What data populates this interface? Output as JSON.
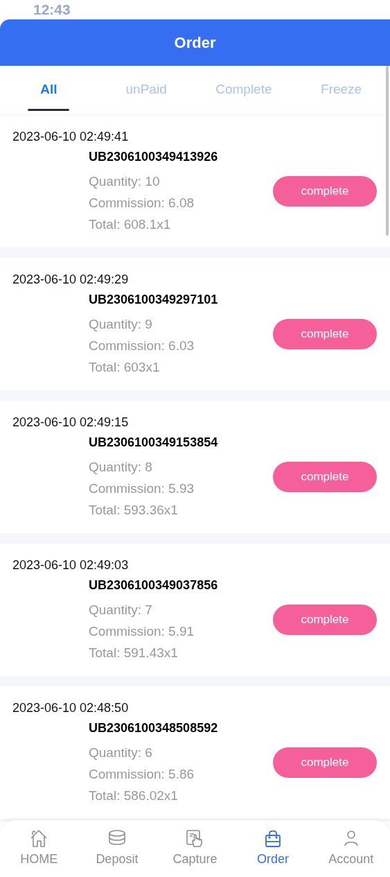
{
  "status_bar": {
    "time": "12:43"
  },
  "header": {
    "title": "Order"
  },
  "tabs": [
    {
      "label": "All",
      "selected": true
    },
    {
      "label": "unPaid",
      "selected": false
    },
    {
      "label": "Complete",
      "selected": false
    },
    {
      "label": "Freeze",
      "selected": false
    }
  ],
  "orders": [
    {
      "time": "2023-06-10 02:49:41",
      "order_no": "UB2306100349413926",
      "quantity": "Quantity: 10",
      "commission": "Commission: 6.08",
      "total": "Total: 608.1x1",
      "action": "complete"
    },
    {
      "time": "2023-06-10 02:49:29",
      "order_no": "UB2306100349297101",
      "quantity": "Quantity: 9",
      "commission": "Commission: 6.03",
      "total": "Total: 603x1",
      "action": "complete"
    },
    {
      "time": "2023-06-10 02:49:15",
      "order_no": "UB2306100349153854",
      "quantity": "Quantity: 8",
      "commission": "Commission: 5.93",
      "total": "Total: 593.36x1",
      "action": "complete"
    },
    {
      "time": "2023-06-10 02:49:03",
      "order_no": "UB2306100349037856",
      "quantity": "Quantity: 7",
      "commission": "Commission: 5.91",
      "total": "Total: 591.43x1",
      "action": "complete"
    },
    {
      "time": "2023-06-10 02:48:50",
      "order_no": "UB2306100348508592",
      "quantity": "Quantity: 6",
      "commission": "Commission: 5.86",
      "total": "Total: 586.02x1",
      "action": "complete"
    }
  ],
  "bottom_nav": [
    {
      "kind": "home",
      "label": "HOME",
      "selected": false
    },
    {
      "kind": "deposit",
      "label": "Deposit",
      "selected": false
    },
    {
      "kind": "capture",
      "label": "Capture",
      "selected": false
    },
    {
      "kind": "order",
      "label": "Order",
      "selected": true
    },
    {
      "kind": "account",
      "label": "Account",
      "selected": false
    }
  ]
}
